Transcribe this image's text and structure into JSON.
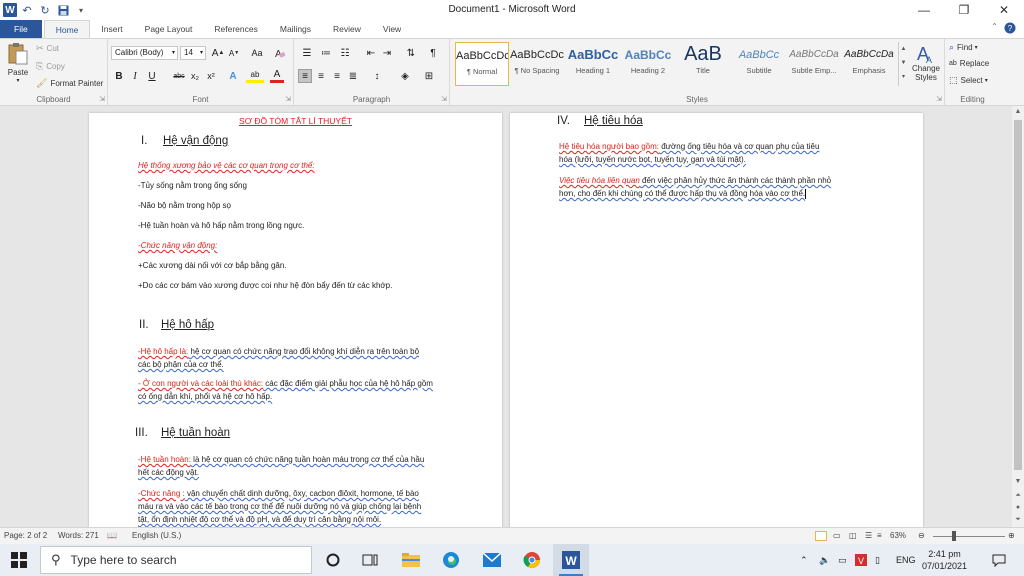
{
  "window": {
    "title": "Document1 - Microsoft Word",
    "app_letter": "W"
  },
  "tabs": [
    "File",
    "Home",
    "Insert",
    "Page Layout",
    "References",
    "Mailings",
    "Review",
    "View"
  ],
  "ribbon": {
    "clipboard": {
      "paste": "Paste",
      "cut": "Cut",
      "copy": "Copy",
      "format_painter": "Format Painter",
      "label": "Clipboard"
    },
    "font": {
      "name": "Calibri (Body)",
      "size": "14",
      "label": "Font",
      "grow": "A",
      "shrink": "A",
      "change_case": "Aa",
      "bold": "B",
      "italic": "I",
      "underline": "U",
      "strike": "abc",
      "sub": "x₂",
      "sup": "x²",
      "effects": "A",
      "highlight": "ab",
      "color": "A"
    },
    "paragraph": {
      "label": "Paragraph"
    },
    "styles": {
      "label": "Styles",
      "items": [
        {
          "preview": "AaBbCcDc",
          "name": "¶ Normal"
        },
        {
          "preview": "AaBbCcDc",
          "name": "¶ No Spacing"
        },
        {
          "preview": "AaBbCc",
          "name": "Heading 1"
        },
        {
          "preview": "AaBbCc",
          "name": "Heading 2"
        },
        {
          "preview": "AaB",
          "name": "Title"
        },
        {
          "preview": "AaBbCc",
          "name": "Subtitle"
        },
        {
          "preview": "AaBbCcDa",
          "name": "Subtle Emp..."
        },
        {
          "preview": "AaBbCcDa",
          "name": "Emphasis"
        }
      ],
      "change_styles": "Change Styles"
    },
    "editing": {
      "label": "Editing",
      "find": "Find",
      "replace": "Replace",
      "select": "Select"
    }
  },
  "page1": {
    "title": "SƠ ĐỒ TÓM TẮT LÍ THUYẾT",
    "sec1": {
      "num": "I.",
      "heading": "Hệ vận động",
      "lines": [
        "Hệ thống xương bảo vệ các cơ quan trong cơ thể:",
        "-Tủy sống nằm trong ống sống",
        "-Não bộ nằm trong hộp sọ",
        "-Hệ tuần hoàn và hô hấp nằm trong lồng ngực.",
        "-Chức năng vận động:",
        "+Các xương dài nối với cơ bắp bằng gân.",
        "+Do các cơ bám vào xương được coi như hệ đòn bẩy đến từ các khớp."
      ]
    },
    "sec2": {
      "num": "II.",
      "heading": "Hệ hô hấp",
      "p1_label": "-Hệ hô hấp là:",
      "p1_l1": " hệ cơ quan có chức năng trao đổi không khí diễn ra trên toàn bộ",
      "p1_l2": "các bộ phận của cơ thể.",
      "p2_label": "- Ở con người và các loài thú khác:",
      "p2_l1": "  các đặc điểm giải phẫu học của hệ hô hấp gồm",
      "p2_l2": "có ống dẫn khí, phổi và hệ cơ hô hấp."
    },
    "sec3": {
      "num": "III.",
      "heading": "Hệ tuần hoàn",
      "p1_label": "-Hệ tuần hoàn:",
      "p1_l1": " là hệ cơ quan có chức năng tuần hoàn máu trong cơ thể của hầu",
      "p1_l2": "hết các động vật.",
      "p2_label": "-Chức năng :",
      "p2_l1": " vận chuyển chất dinh dưỡng, ôxy, cacbon điôxit, hormone, tế bào",
      "p2_l2": "máu ra và vào các tế bào trong cơ thể để nuôi dưỡng nó và giúp chống lại bệnh",
      "p2_l3": "tật, ổn định nhiệt độ cơ thể và độ pH, và để duy trì cân bằng nội môi."
    }
  },
  "page2": {
    "sec4": {
      "num": "IV.",
      "heading": "Hệ tiêu hóa",
      "p1_label": "Hệ tiêu hóa người bao gồm:",
      "p1_l1": " đường ống tiêu hóa và cơ quan phụ của tiêu",
      "p1_l2": "hóa (lưỡi, tuyến nước bọt, tuyến tụy, gan và túi mật).",
      "p2_label": "Việc tiêu hóa liên quan",
      "p2_l1": " đến việc phân hủy thức ăn thành các thành phần nhỏ",
      "p2_l2": "hơn, cho đến khi chúng có thể được hấp thụ và đồng hóa vào cơ thể."
    }
  },
  "status": {
    "page": "Page: 2 of 2",
    "words": "Words: 271",
    "language": "English (U.S.)",
    "zoom": "63%"
  },
  "taskbar": {
    "search_placeholder": "Type here to search",
    "lang": "ENG",
    "time": "2:41 pm",
    "date": "07/01/2021"
  }
}
